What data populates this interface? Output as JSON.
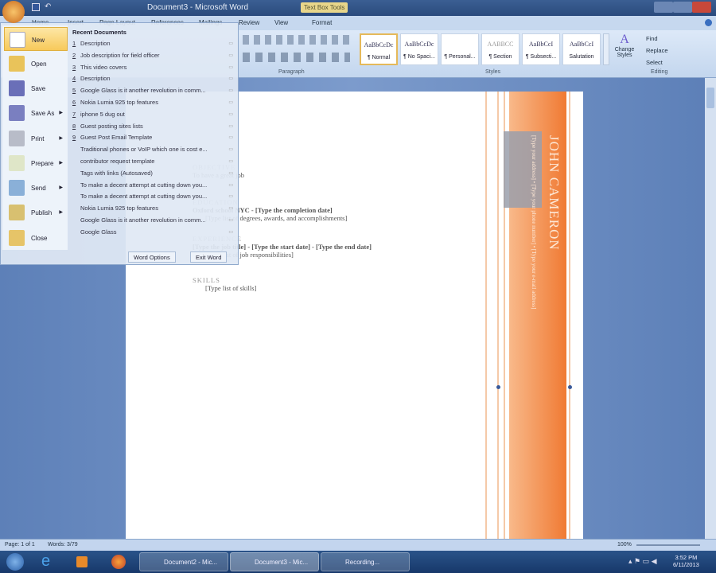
{
  "window": {
    "title": "Document3 - Microsoft Word",
    "context_tab": "Text Box Tools"
  },
  "tabs": [
    "Home",
    "Insert",
    "Page Layout",
    "References",
    "Mailings",
    "Review",
    "View",
    "Format"
  ],
  "ribbon": {
    "styles": [
      {
        "sample": "AaBbCcDc",
        "name": "¶ Normal"
      },
      {
        "sample": "AaBbCcDc",
        "name": "¶ No Spaci..."
      },
      {
        "sample": "",
        "name": "¶ Personal..."
      },
      {
        "sample": "AABBCC",
        "name": "¶ Section"
      },
      {
        "sample": "AaBbCcI",
        "name": "¶ Subsecti..."
      },
      {
        "sample": "AaBbCcI",
        "name": "Salutation"
      }
    ],
    "change_styles": "Change Styles",
    "editing": [
      "Find",
      "Replace",
      "Select"
    ],
    "groups": {
      "paragraph": "Paragraph",
      "styles": "Styles",
      "editing": "Editing"
    }
  },
  "office_menu": {
    "commands": [
      {
        "label": "New",
        "arrow": false
      },
      {
        "label": "Open",
        "arrow": false
      },
      {
        "label": "Save",
        "arrow": false
      },
      {
        "label": "Save As",
        "arrow": true
      },
      {
        "label": "Print",
        "arrow": true
      },
      {
        "label": "Prepare",
        "arrow": true
      },
      {
        "label": "Send",
        "arrow": true
      },
      {
        "label": "Publish",
        "arrow": true
      },
      {
        "label": "Close",
        "arrow": false
      }
    ],
    "recent_title": "Recent Documents",
    "recent": [
      {
        "num": "1",
        "name": "Description"
      },
      {
        "num": "2",
        "name": "Job description for field officer"
      },
      {
        "num": "3",
        "name": "This video covers"
      },
      {
        "num": "4",
        "name": "Description"
      },
      {
        "num": "5",
        "name": "Google Glass is it another revolution in comm..."
      },
      {
        "num": "6",
        "name": "Nokia Lumia 925 top features"
      },
      {
        "num": "7",
        "name": "iphone 5 dug out"
      },
      {
        "num": "8",
        "name": "Guest posting sites lists"
      },
      {
        "num": "9",
        "name": "Guest Post Email Template"
      },
      {
        "num": "",
        "name": "Traditional phones or VoIP which one is cost e..."
      },
      {
        "num": "",
        "name": "contributor request template"
      },
      {
        "num": "",
        "name": "Tags with links (Autosaved)"
      },
      {
        "num": "",
        "name": "To make a decent attempt at cutting down you..."
      },
      {
        "num": "",
        "name": "To make a decent attempt at cutting down you..."
      },
      {
        "num": "",
        "name": "Nokia Lumia 925 top features"
      },
      {
        "num": "",
        "name": "Google Glass is it another revolution in comm..."
      },
      {
        "num": "",
        "name": "Google Glass"
      }
    ],
    "word_options": "Word Options",
    "exit_word": "Exit Word"
  },
  "document": {
    "objective_head": "OBJECTIVE",
    "objective": "To have a great job",
    "education_head": "EDUCATION",
    "education": "Oxford school NYC - [Type the completion date]",
    "education_detail": "[Type list of degrees, awards, and accomplishments]",
    "experience_head": "EXPERIENCE",
    "experience": "[Type the job title] - [Type the start date] - [Type the end date]",
    "experience_detail": "[Type list of job responsibilities]",
    "skills_head": "SKILLS",
    "skills_detail": "[Type list of skills]",
    "name": "JOHN CAMERON",
    "contact": "[Type your address] • [Type your phone number] • [Type your e-mail address]"
  },
  "status": {
    "page": "Page: 1 of 1",
    "words": "Words: 3/79",
    "zoom": "100%"
  },
  "taskbar": {
    "items": [
      "Document2 - Mic...",
      "Document3 - Mic...",
      "Recording..."
    ],
    "time": "3:52 PM",
    "date": "6/11/2013"
  }
}
